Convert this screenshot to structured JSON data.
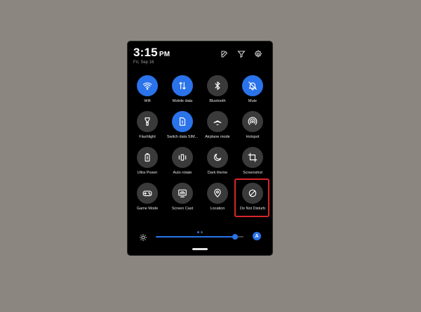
{
  "status": {
    "time": "3:15",
    "ampm": "PM",
    "date": "Fri, Sep 16"
  },
  "header_icons": [
    "edit-icon",
    "filter-icon",
    "settings-icon"
  ],
  "tiles": [
    {
      "label": "Wifi",
      "icon": "wifi-icon",
      "on": true
    },
    {
      "label": "Mobile data",
      "icon": "mobile-data-icon",
      "on": true
    },
    {
      "label": "Bluetooth",
      "icon": "bluetooth-icon",
      "on": false
    },
    {
      "label": "Mute",
      "icon": "mute-icon",
      "on": true
    },
    {
      "label": "Flashlight",
      "icon": "flashlight-icon",
      "on": false
    },
    {
      "label": "Switch data SIM...",
      "icon": "sim-icon",
      "on": true
    },
    {
      "label": "Airplane mode",
      "icon": "airplane-icon",
      "on": false
    },
    {
      "label": "Hotspot",
      "icon": "hotspot-icon",
      "on": false
    },
    {
      "label": "Ultra Power",
      "icon": "battery-icon",
      "on": false
    },
    {
      "label": "Auto rotate",
      "icon": "auto-rotate-icon",
      "on": false
    },
    {
      "label": "Dark theme",
      "icon": "moon-icon",
      "on": false
    },
    {
      "label": "Screenshot",
      "icon": "crop-icon",
      "on": false
    },
    {
      "label": "Game Mode",
      "icon": "gamepad-icon",
      "on": false
    },
    {
      "label": "Screen Cast",
      "icon": "cast-icon",
      "on": false
    },
    {
      "label": "Location",
      "icon": "location-icon",
      "on": false
    },
    {
      "label": "Do Not Disturb",
      "icon": "do-not-disturb-icon",
      "on": false
    }
  ],
  "brightness": {
    "level": 0.9,
    "auto_label": "A"
  },
  "pager": {
    "pages": 2,
    "active": 0
  },
  "colors": {
    "accent": "#2a73ea",
    "tile_off": "#3a3a3a",
    "highlight": "#d9252b",
    "backdrop": "#8b8680"
  }
}
